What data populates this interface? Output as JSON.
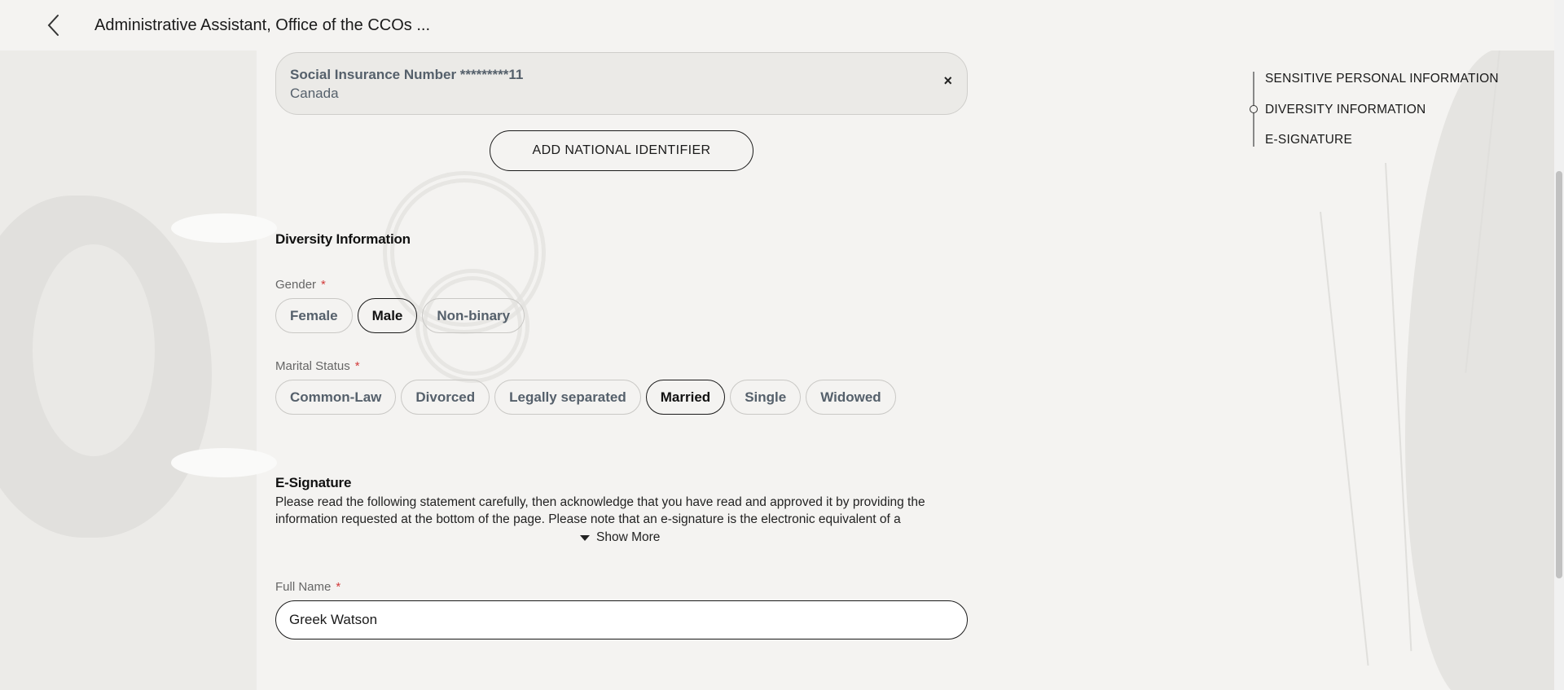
{
  "header": {
    "title": "Administrative Assistant, Office of the CCOs ..."
  },
  "national_identifier": {
    "label": "Social Insurance Number *********11",
    "country": "Canada",
    "remove_symbol": "×",
    "add_button": "ADD NATIONAL IDENTIFIER"
  },
  "diversity": {
    "heading": "Diversity Information",
    "gender": {
      "label": "Gender",
      "required_mark": "*",
      "options": [
        "Female",
        "Male",
        "Non-binary"
      ],
      "selected": "Male"
    },
    "marital_status": {
      "label": "Marital Status",
      "required_mark": "*",
      "options": [
        "Common-Law",
        "Divorced",
        "Legally separated",
        "Married",
        "Single",
        "Widowed"
      ],
      "selected": "Married"
    }
  },
  "esignature": {
    "heading": "E-Signature",
    "text": "Please read the following statement carefully, then acknowledge that you have read and approved it by providing the information requested at the bottom of the page. Please note that an e-signature is the electronic equivalent of a",
    "show_more": "Show More",
    "full_name": {
      "label": "Full Name",
      "required_mark": "*",
      "value": "Greek Watson"
    }
  },
  "side_nav": {
    "items": [
      "SENSITIVE PERSONAL INFORMATION",
      "DIVERSITY INFORMATION",
      "E-SIGNATURE"
    ],
    "active": "DIVERSITY INFORMATION"
  },
  "icons": {
    "back": "chevron-left-icon",
    "remove": "close-icon",
    "show_more": "caret-down-icon"
  }
}
